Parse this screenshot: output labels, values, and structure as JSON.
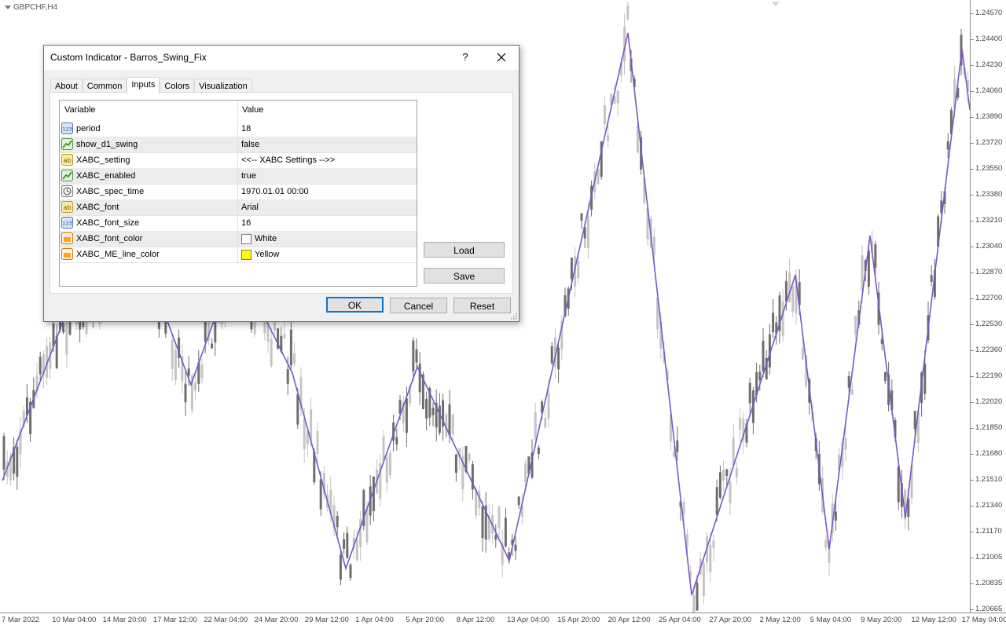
{
  "chart": {
    "symbol": "GBPCHF,H4",
    "price_labels": [
      "1.24570",
      "1.24400",
      "1.24230",
      "1.24060",
      "1.23890",
      "1.23720",
      "1.23550",
      "1.23380",
      "1.23210",
      "1.23040",
      "1.22870",
      "1.22700",
      "1.22530",
      "1.22360",
      "1.22190",
      "1.22020",
      "1.21850",
      "1.21680",
      "1.21510",
      "1.21340",
      "1.21170",
      "1.21005",
      "1.20835",
      "1.20665"
    ],
    "time_labels": [
      "7 Mar 2022",
      "10 Mar 04:00",
      "14 Mar 20:00",
      "17 Mar 12:00",
      "22 Mar 04:00",
      "24 Mar 20:00",
      "29 Mar 12:00",
      "1 Apr 04:00",
      "5 Apr 20:00",
      "8 Apr 12:00",
      "13 Apr 04:00",
      "15 Apr 20:00",
      "20 Apr 12:00",
      "25 Apr 04:00",
      "27 Apr 20:00",
      "2 May 12:00",
      "5 May 04:00",
      "9 May 20:00",
      "12 May 12:00",
      "17 May 04:00"
    ],
    "colors": {
      "bull": "#c4c4c4",
      "bear": "#6e6e6e",
      "swing": "#7b57c9",
      "axis": "#8a8a8a"
    }
  },
  "dialog": {
    "title": "Custom Indicator - Barros_Swing_Fix",
    "help_label": "?",
    "tabs": [
      {
        "label": "About",
        "active": false
      },
      {
        "label": "Common",
        "active": false
      },
      {
        "label": "Inputs",
        "active": true
      },
      {
        "label": "Colors",
        "active": false
      },
      {
        "label": "Visualization",
        "active": false
      }
    ],
    "grid": {
      "col_variable": "Variable",
      "col_value": "Value",
      "rows": [
        {
          "name": "period",
          "value": "18",
          "icon": "integer-icon"
        },
        {
          "name": "show_d1_swing",
          "value": "false",
          "icon": "bool-icon"
        },
        {
          "name": "XABC_setting",
          "value": "<<-- XABC Settings -->>",
          "icon": "string-icon"
        },
        {
          "name": "XABC_enabled",
          "value": "true",
          "icon": "bool-icon"
        },
        {
          "name": "XABC_spec_time",
          "value": "1970.01.01 00:00",
          "icon": "datetime-icon"
        },
        {
          "name": "XABC_font",
          "value": "Arial",
          "icon": "string-icon"
        },
        {
          "name": "XABC_font_size",
          "value": "16",
          "icon": "integer-icon"
        },
        {
          "name": "XABC_font_color",
          "value": "White",
          "icon": "color-icon",
          "swatch": "#ffffff"
        },
        {
          "name": "XABC_ME_line_color",
          "value": "Yellow",
          "icon": "color-icon",
          "swatch": "#ffff00"
        }
      ]
    },
    "buttons": {
      "load": "Load",
      "save": "Save",
      "ok": "OK",
      "cancel": "Cancel",
      "reset": "Reset"
    }
  }
}
